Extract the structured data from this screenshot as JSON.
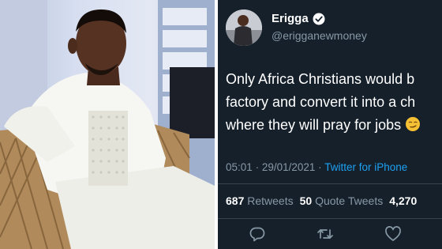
{
  "tweet": {
    "display_name": "Erigga",
    "handle": "@erigganewmoney",
    "text_lines": [
      "Only Africa Christians would b",
      "factory and convert it into a ch",
      "where they will pray for jobs"
    ],
    "time": "05:01",
    "date_sep": "·",
    "date": "29/01/2021",
    "source_sep": "·",
    "source": "Twitter for iPhone",
    "retweets_count": "687",
    "retweets_label": "Retweets",
    "quote_count": "50",
    "quote_label": "Quote Tweets",
    "likes_count": "4,270"
  },
  "icons": {
    "verified": "verified-badge-icon",
    "emoji": "smirk-emoji-icon",
    "reply": "reply-icon",
    "retweet": "retweet-icon",
    "like": "heart-icon"
  },
  "colors": {
    "background": "#15202b",
    "text": "#ffffff",
    "secondary": "#8899a6",
    "accent": "#1da1f2",
    "border": "#38444d"
  }
}
